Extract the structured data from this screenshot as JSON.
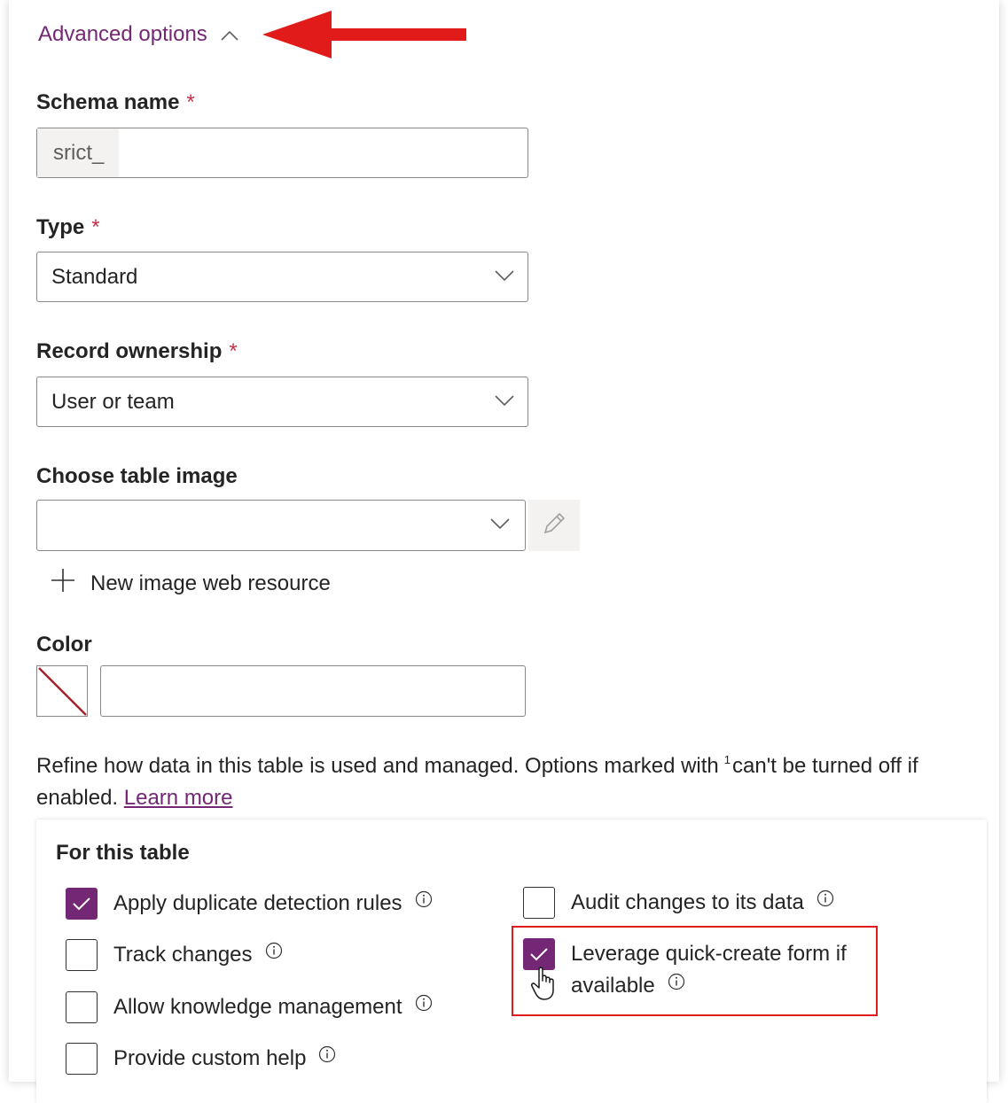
{
  "advanced": {
    "label": "Advanced options",
    "accent_color": "#742774",
    "annotation_color": "#e11a1a"
  },
  "schema": {
    "label": "Schema name",
    "required_mark": "*",
    "prefix": "srict_",
    "value": ""
  },
  "type": {
    "label": "Type",
    "required_mark": "*",
    "value": "Standard"
  },
  "ownership": {
    "label": "Record ownership",
    "required_mark": "*",
    "value": "User or team"
  },
  "table_image": {
    "label": "Choose table image",
    "value": "",
    "new_resource_label": "New image web resource"
  },
  "color": {
    "label": "Color",
    "value": ""
  },
  "description": {
    "text_before": "Refine how data in this table is used and managed. Options marked with",
    "superscript": "1",
    "text_after": "can't be turned off if enabled.",
    "link": "Learn more"
  },
  "for_this_table": {
    "title": "For this table",
    "options": [
      {
        "label": "Apply duplicate detection rules",
        "checked": true
      },
      {
        "label": "Track changes",
        "checked": false
      },
      {
        "label": "Allow knowledge management",
        "checked": false
      },
      {
        "label": "Provide custom help",
        "checked": false
      },
      {
        "label": "Audit changes to its data",
        "checked": false
      },
      {
        "label": "Leverage quick-create form if available",
        "checked": true
      }
    ]
  }
}
